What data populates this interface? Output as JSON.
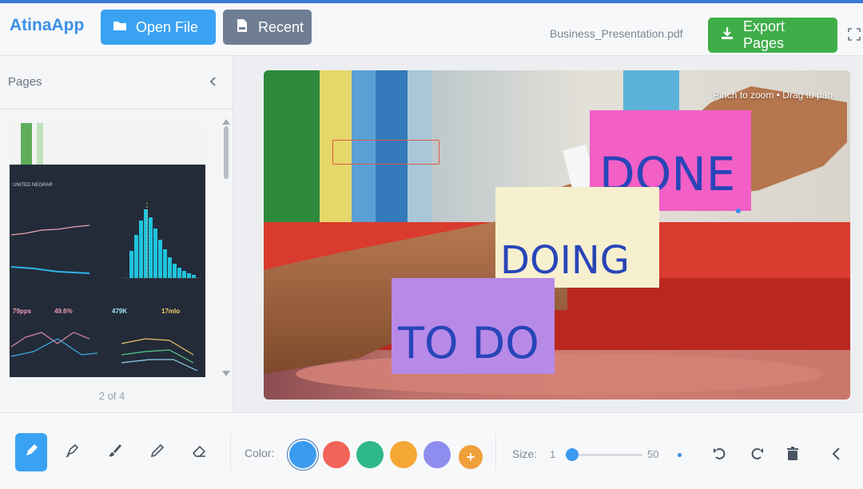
{
  "app": {
    "brand": "AtinaApp",
    "accent": "#3aa2f2"
  },
  "header": {
    "open_file_label": "Open File",
    "recent_label": "Recent",
    "filename": "Business_Presentation.pdf",
    "export_label": "Export Pages",
    "icons": [
      "folder-icon",
      "pdf-file-icon",
      "download-icon",
      "fullscreen-icon"
    ]
  },
  "sidebar": {
    "title": "Pages",
    "page_indicator": "2 of 4",
    "thumbnail_dashboard": {
      "title": "UNITED NEGRAR",
      "kpis": [
        "79pps",
        "49.6%",
        "479K",
        "17mlo"
      ]
    }
  },
  "canvas": {
    "hint": "Pinch to zoom • Drag to pan",
    "notes": [
      {
        "text": "DONE",
        "color": "#f25fc5"
      },
      {
        "text": "DOING",
        "color": "#f6f0cf"
      },
      {
        "text": "TO DO",
        "color": "#b78ae8"
      }
    ]
  },
  "toolbar": {
    "tools": [
      "pen-icon",
      "marker-icon",
      "brush-icon",
      "pencil-icon",
      "eraser-icon"
    ],
    "active_tool": "pen-icon",
    "color_label": "Color:",
    "colors": [
      "#3a9af0",
      "#f26458",
      "#2fb88a",
      "#f5a735",
      "#8f8cf0"
    ],
    "selected_color": "#3a9af0",
    "add_color_symbol": "+",
    "size_label": "Size:",
    "size_min": "1",
    "size_max": "50",
    "size_value": 1
  }
}
